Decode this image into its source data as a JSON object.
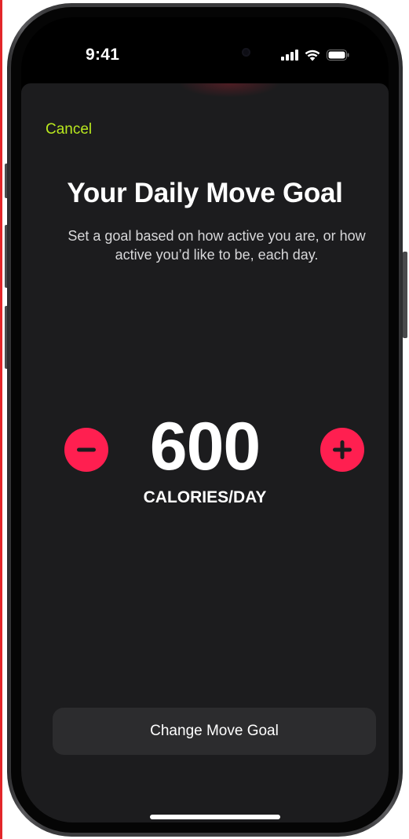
{
  "status_bar": {
    "time": "9:41",
    "icons": [
      "cellular-signal-icon",
      "wifi-icon",
      "battery-icon"
    ]
  },
  "sheet": {
    "cancel_label": "Cancel",
    "title": "Your Daily Move Goal",
    "subtitle": "Set a goal based on how active you are, or how active you’d like to be, each day.",
    "goal": {
      "value": "600",
      "unit": "CALORIES/DAY",
      "decrease_icon": "minus-icon",
      "increase_icon": "plus-icon"
    },
    "primary_button_label": "Change Move Goal"
  },
  "colors": {
    "accent_cancel": "#b9e81e",
    "stepper_button": "#ff1f50",
    "sheet_background": "#1c1c1e",
    "button_background": "#2c2c2e"
  }
}
